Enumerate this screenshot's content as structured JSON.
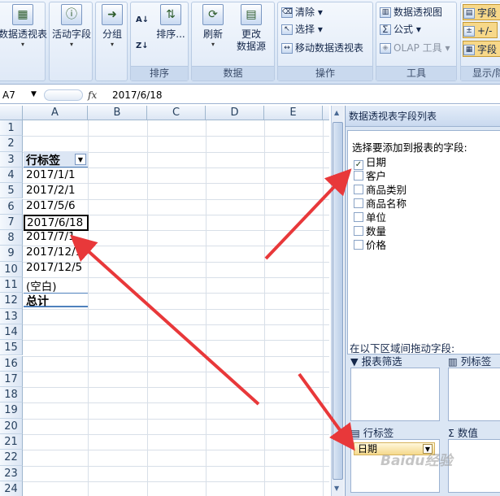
{
  "ribbon": {
    "pivot_table_btn": "数据透视表",
    "active_field_btn": "活动字段",
    "group_btn": "分组",
    "sort_btn": "排序...",
    "sort_group_label": "排序",
    "refresh_btn": "刷新",
    "change_source_btn": "更改\n数据源",
    "data_group_label": "数据",
    "clear_btn": "清除",
    "select_btn": "选择",
    "move_btn": "移动数据透视表",
    "actions_group_label": "操作",
    "pivot_chart_btn": "数据透视图",
    "formula_btn": "公式",
    "olap_btn": "OLAP 工具",
    "tools_group_label": "工具",
    "field_list_btn": "字段",
    "plusminus_btn": "+/-",
    "field_header_btn": "字段",
    "show_group_label": "显示/隐"
  },
  "formula_bar": {
    "name_box": "A7",
    "fx": "fx",
    "value": "2017/6/18"
  },
  "grid": {
    "columns": [
      "A",
      "B",
      "C",
      "D",
      "E"
    ],
    "rows": [
      "1",
      "2",
      "3",
      "4",
      "5",
      "6",
      "7",
      "8",
      "9",
      "10",
      "11",
      "12",
      "13",
      "14",
      "15",
      "16",
      "17",
      "18",
      "19",
      "20",
      "21",
      "22",
      "23",
      "24"
    ],
    "header_label": "行标签",
    "items": [
      "2017/1/1",
      "2017/2/1",
      "2017/5/6",
      "2017/6/18",
      "2017/7/1",
      "2017/12/1",
      "2017/12/5",
      "(空白)"
    ],
    "total_label": "总计"
  },
  "panel": {
    "title": "数据透视表字段列表",
    "choose_label": "选择要添加到报表的字段:",
    "fields": [
      {
        "name": "日期",
        "checked": true
      },
      {
        "name": "客户",
        "checked": false
      },
      {
        "name": "商品类别",
        "checked": false
      },
      {
        "name": "商品名称",
        "checked": false
      },
      {
        "name": "单位",
        "checked": false
      },
      {
        "name": "数量",
        "checked": false
      },
      {
        "name": "价格",
        "checked": false
      }
    ],
    "drag_label": "在以下区域间拖动字段:",
    "filter_label": "报表筛选",
    "col_label": "列标签",
    "row_label": "行标签",
    "values_label": "数值",
    "row_chip": "日期"
  },
  "watermark": "Baidu经验",
  "colors": {
    "arrow": "#e8383a",
    "accent": "#4f81bd"
  }
}
